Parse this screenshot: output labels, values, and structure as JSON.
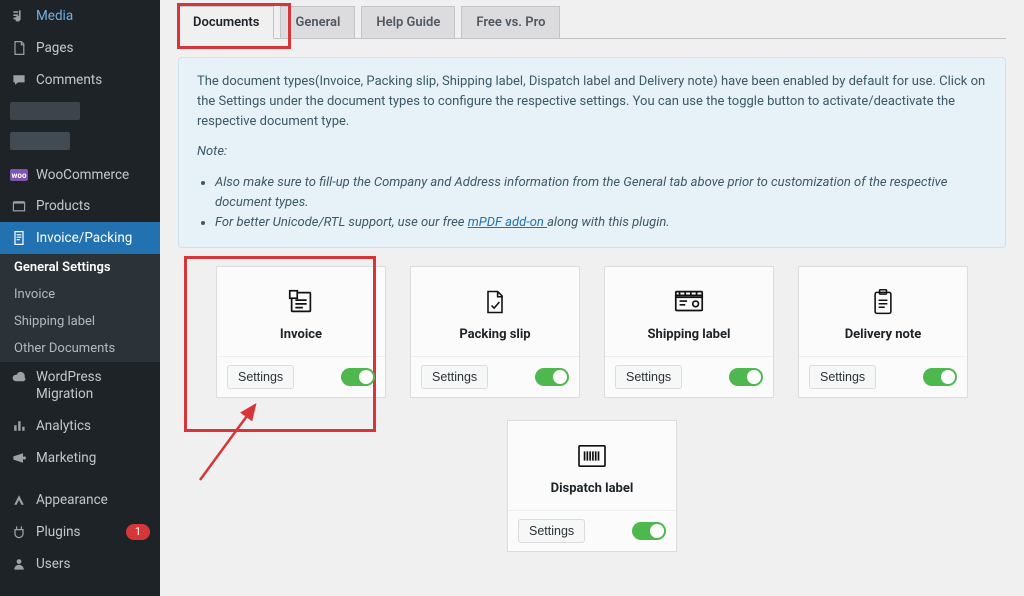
{
  "sidebar": {
    "items": [
      {
        "label": "Media"
      },
      {
        "label": "Pages"
      },
      {
        "label": "Comments"
      },
      {
        "label": "WooCommerce"
      },
      {
        "label": "Products"
      },
      {
        "label": "Invoice/Packing"
      },
      {
        "label": "WordPress Migration"
      },
      {
        "label": "Analytics"
      },
      {
        "label": "Marketing"
      },
      {
        "label": "Appearance"
      },
      {
        "label": "Plugins"
      },
      {
        "label": "Users"
      }
    ],
    "plugins_badge": "1",
    "submenu": [
      {
        "label": "General Settings"
      },
      {
        "label": "Invoice"
      },
      {
        "label": "Shipping label"
      },
      {
        "label": "Other Documents"
      }
    ]
  },
  "tabs": {
    "items": [
      {
        "label": "Documents"
      },
      {
        "label": "General"
      },
      {
        "label": "Help Guide"
      },
      {
        "label": "Free vs. Pro"
      }
    ]
  },
  "notice": {
    "text": "The document types(Invoice, Packing slip, Shipping label, Dispatch label and Delivery note) have been enabled by default for use. Click on the Settings under the document types to configure the respective settings. You can use the toggle button to activate/deactivate the respective document type.",
    "note_label": "Note:",
    "li1_a": "Also make sure to fill-up the Company and Address information from the General tab above prior to customization of the respective document types.",
    "li2_a": "For better Unicode/RTL support, use our free ",
    "li2_link": "mPDF add-on ",
    "li2_b": "along with this plugin."
  },
  "cards": {
    "invoice": {
      "title": "Invoice",
      "settings": "Settings"
    },
    "packing": {
      "title": "Packing slip",
      "settings": "Settings"
    },
    "shipping": {
      "title": "Shipping label",
      "settings": "Settings"
    },
    "delivery": {
      "title": "Delivery note",
      "settings": "Settings"
    },
    "dispatch": {
      "title": "Dispatch label",
      "settings": "Settings"
    }
  }
}
